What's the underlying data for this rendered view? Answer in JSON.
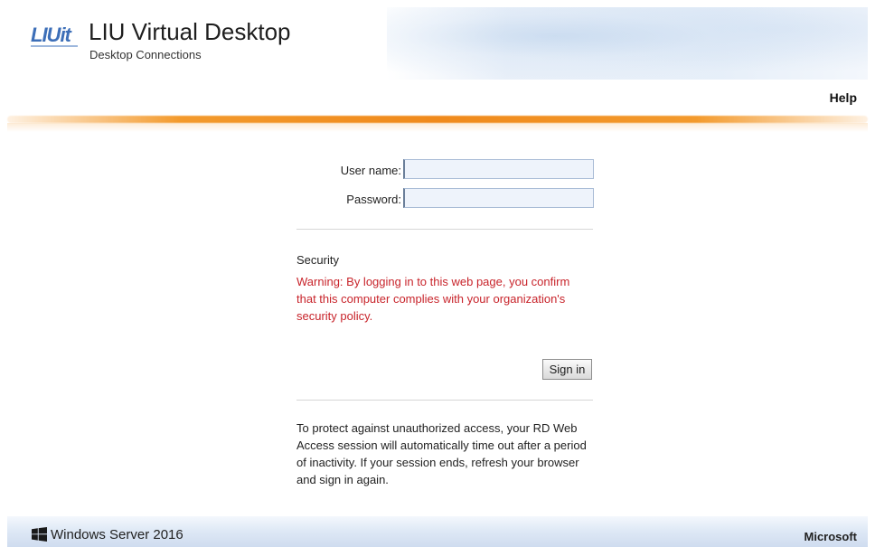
{
  "header": {
    "logo_text": "LIUit",
    "title": "LIU Virtual Desktop",
    "subtitle": "Desktop Connections",
    "help_link": "Help"
  },
  "form": {
    "username_label": "User name:",
    "username_value": "",
    "password_label": "Password:",
    "password_value": "",
    "security_heading": "Security",
    "warning_text": "Warning: By logging in to this web page, you confirm that this computer complies with your organization's security policy.",
    "sign_in_label": "Sign in",
    "info_text": "To protect against unauthorized access, your RD Web Access session will automatically time out after a period of inactivity. If your session ends, refresh your browser and sign in again."
  },
  "footer": {
    "product": "Windows Server 2016",
    "vendor": "Microsoft",
    "product_icon": "windows-logo-icon"
  },
  "colors": {
    "accent_orange": "#f08a1c",
    "warning_red": "#c8242b",
    "logo_blue": "#3d6fb8",
    "input_bg": "#eef3fb"
  }
}
